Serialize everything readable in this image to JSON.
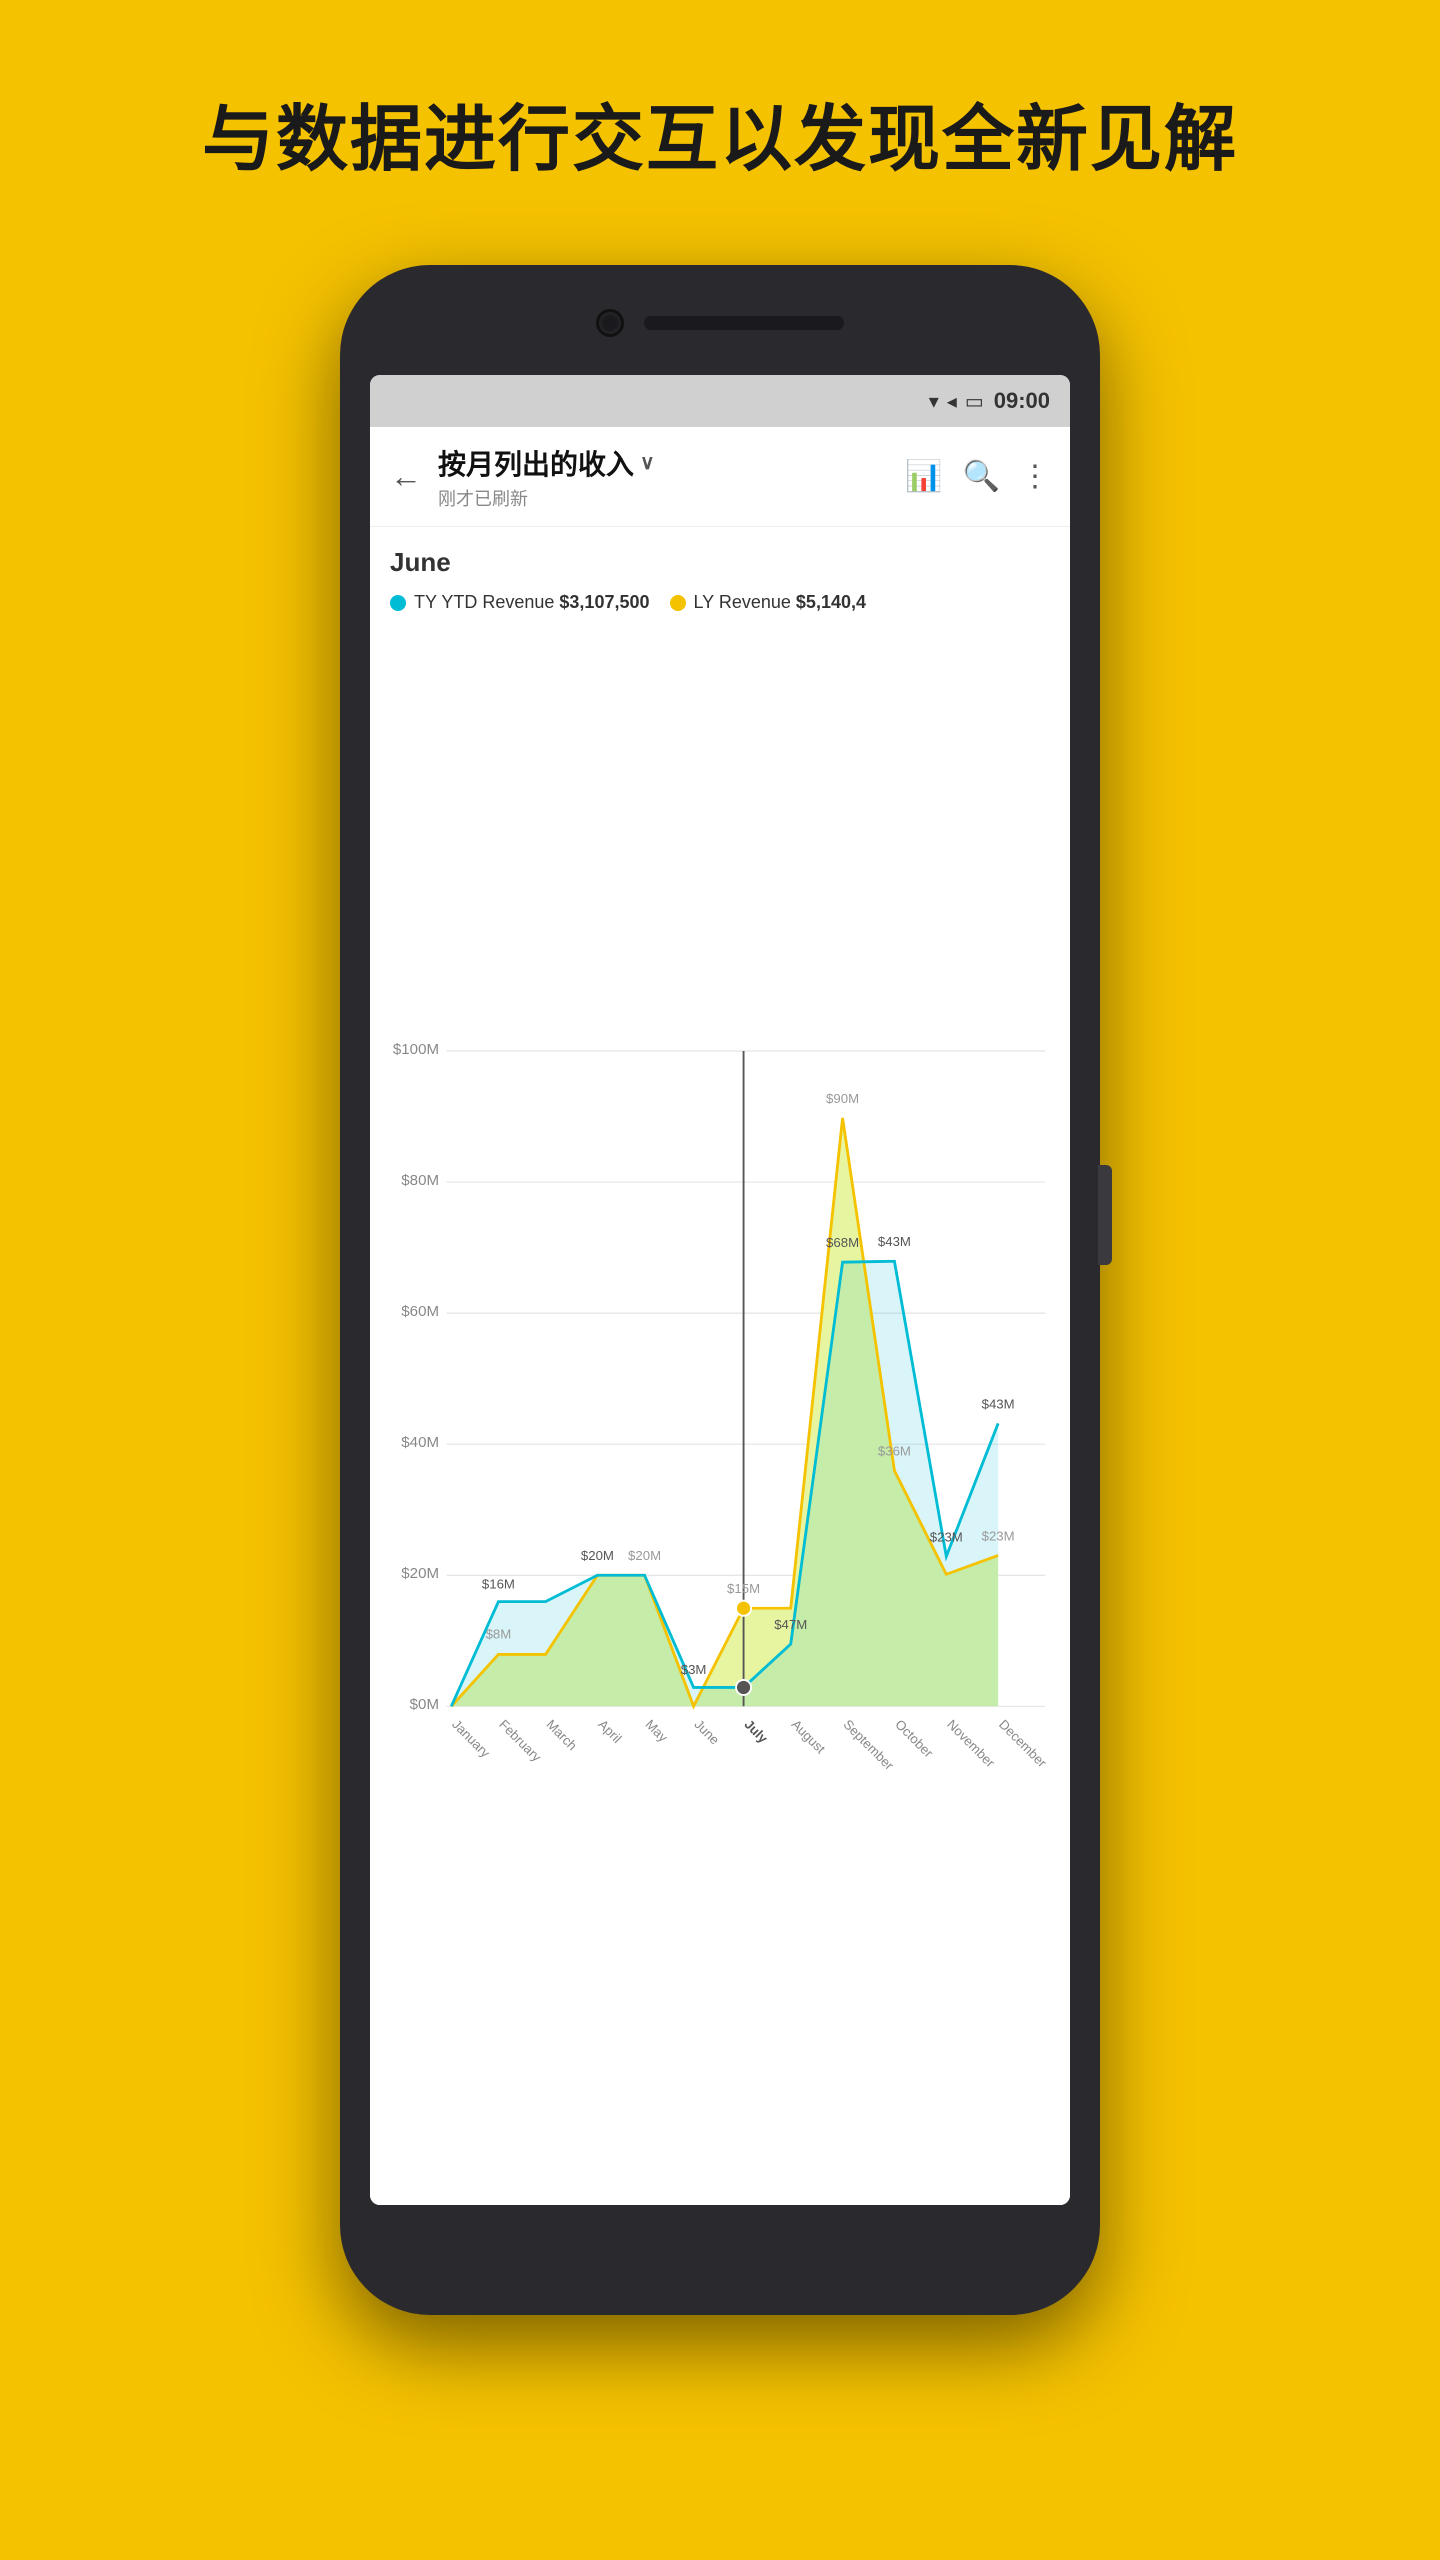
{
  "headline": "与数据进行交互以发现全新见解",
  "status_bar": {
    "time": "09:00",
    "wifi": "▼",
    "signal": "▲",
    "battery": "▭"
  },
  "app_bar": {
    "title": "按月列出的收入",
    "subtitle": "刚才已刷新",
    "back_label": "←",
    "dropdown_arrow": "∨"
  },
  "chart": {
    "selected_month": "June",
    "legend": [
      {
        "label": "TY YTD Revenue",
        "value": "$3,107,500",
        "color": "#00BCD4",
        "type": "teal"
      },
      {
        "label": "LY Revenue",
        "value": "$5,140,4",
        "color": "#F5C200",
        "type": "yellow"
      }
    ],
    "y_axis_labels": [
      "$100M",
      "$80M",
      "$60M",
      "$40M",
      "$20M",
      "$0M"
    ],
    "x_axis_labels": [
      "January",
      "February",
      "March",
      "April",
      "May",
      "June",
      "July",
      "August",
      "September",
      "October",
      "November",
      "December"
    ],
    "data_labels_teal": {
      "February": "$16M",
      "April": "$20M",
      "June": "$3M",
      "August": "$47M",
      "September": "$68M",
      "October": "$43M",
      "November": "$23M",
      "December": "$43M"
    },
    "data_labels_yellow": {
      "February": "$8M",
      "May": "$20M",
      "July": "$15M",
      "September": "$90M",
      "October": "$36M",
      "November": "$23M",
      "December": "$23M"
    }
  }
}
